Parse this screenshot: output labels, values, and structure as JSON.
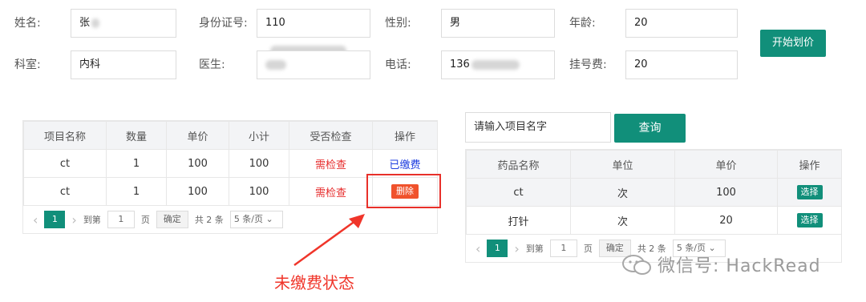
{
  "form": {
    "name_label": "姓名:",
    "name_value": "张",
    "id_label": "身份证号:",
    "id_value": "110",
    "gender_label": "性别:",
    "gender_value": "男",
    "age_label": "年龄:",
    "age_value": "20",
    "dept_label": "科室:",
    "dept_value": "内科",
    "doctor_label": "医生:",
    "phone_label": "电话:",
    "phone_value": "136",
    "fee_label": "挂号费:",
    "fee_value": "20",
    "start_button": "开始划价"
  },
  "left_table": {
    "headers": [
      "项目名称",
      "数量",
      "单价",
      "小计",
      "受否检查",
      "操作"
    ],
    "rows": [
      {
        "name": "ct",
        "qty": "1",
        "price": "100",
        "subtotal": "100",
        "check": "需检查",
        "action": "已缴费"
      },
      {
        "name": "ct",
        "qty": "1",
        "price": "100",
        "subtotal": "100",
        "check": "需检查",
        "action": "删除"
      }
    ],
    "pager": {
      "prev": "‹",
      "current": "1",
      "next": "›",
      "goto": "到第",
      "page_input": "1",
      "page_unit": "页",
      "confirm": "确定",
      "total": "共 2 条",
      "page_size": "5 条/页"
    }
  },
  "search": {
    "placeholder": "请输入项目名字",
    "button": "查询"
  },
  "right_table": {
    "headers": [
      "药品名称",
      "单位",
      "单价",
      "操作"
    ],
    "rows": [
      {
        "name": "ct",
        "unit": "次",
        "price": "100",
        "action": "选择"
      },
      {
        "name": "打针",
        "unit": "次",
        "price": "20",
        "action": "选择"
      }
    ],
    "pager": {
      "prev": "‹",
      "current": "1",
      "next": "›",
      "goto": "到第",
      "page_input": "1",
      "page_unit": "页",
      "confirm": "确定",
      "total": "共 2 条",
      "page_size": "5 条/页"
    }
  },
  "annotation": {
    "text": "未缴费状态",
    "color": "#f0352a"
  },
  "watermark": {
    "text": "微信号: HackRead"
  }
}
